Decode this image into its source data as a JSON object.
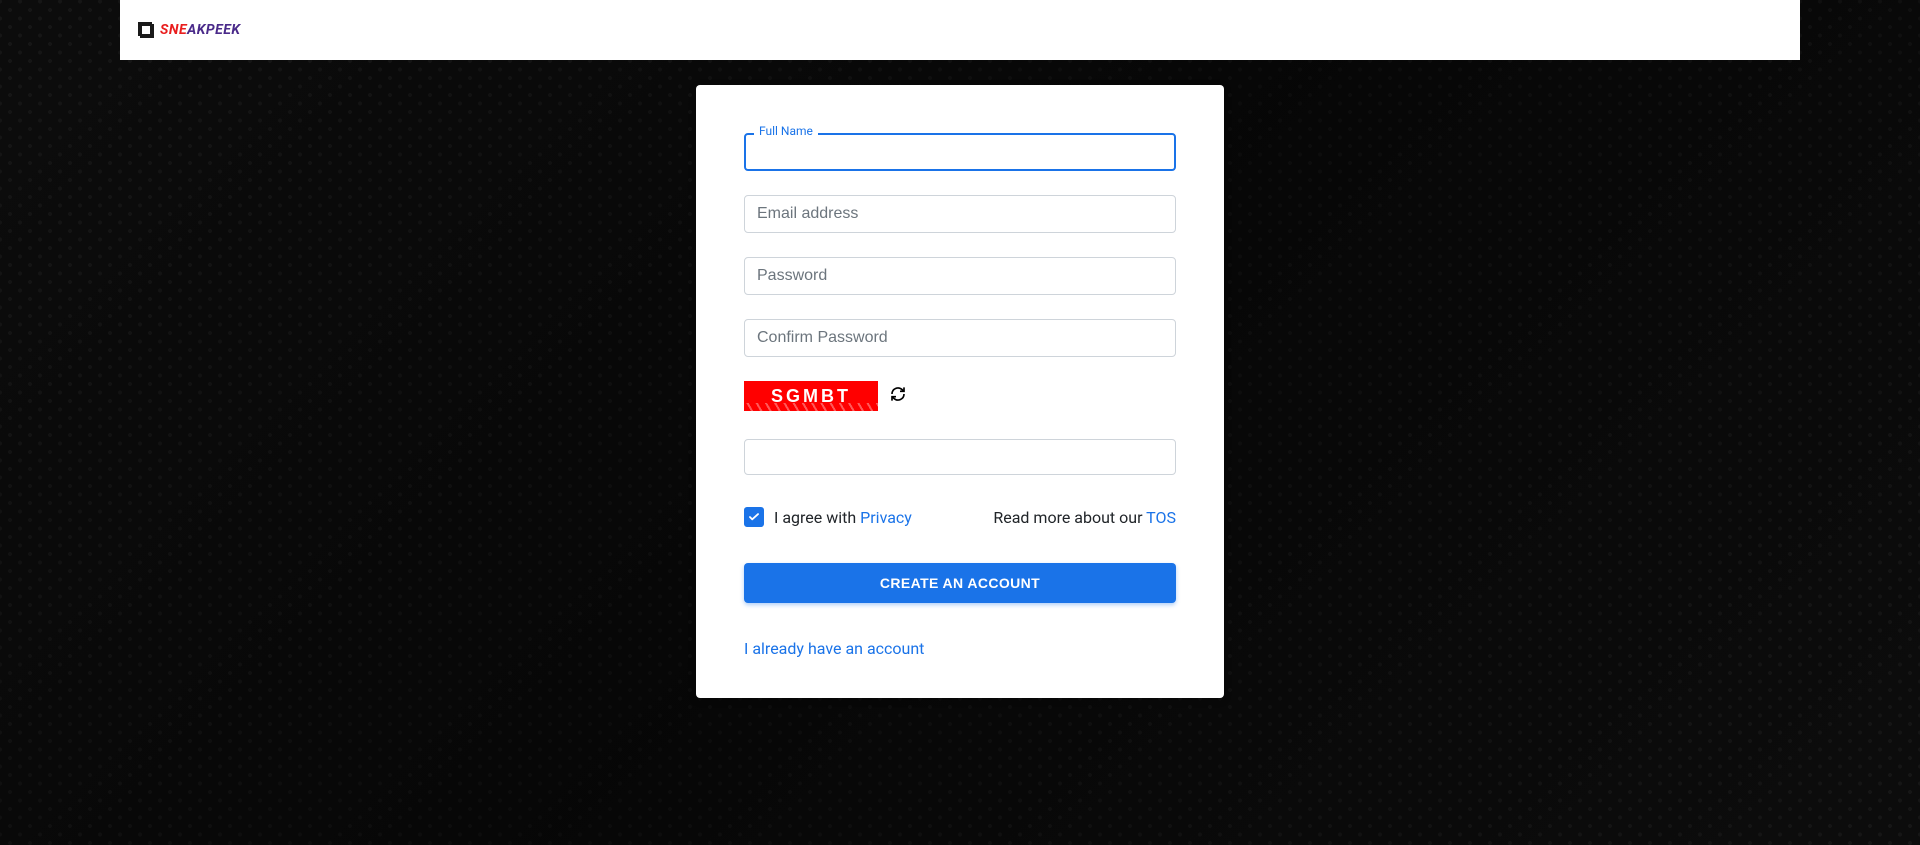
{
  "brand": {
    "name_part1": "SNE",
    "name_part2": "AKPEEK"
  },
  "form": {
    "full_name_label": "Full Name",
    "full_name_value": "",
    "email_placeholder": "Email address",
    "email_value": "",
    "password_placeholder": "Password",
    "password_value": "",
    "confirm_placeholder": "Confirm Password",
    "confirm_value": "",
    "captcha_text": "SGMBT",
    "captcha_value": ""
  },
  "agree": {
    "checked": true,
    "prefix": "I agree with ",
    "privacy_link": "Privacy",
    "tos_prefix": "Read more about our ",
    "tos_link": "TOS"
  },
  "actions": {
    "submit_label": "CREATE AN ACCOUNT",
    "existing_account": "I already have an account"
  },
  "colors": {
    "primary": "#1a73e8",
    "captcha_bg": "#ff0000"
  }
}
